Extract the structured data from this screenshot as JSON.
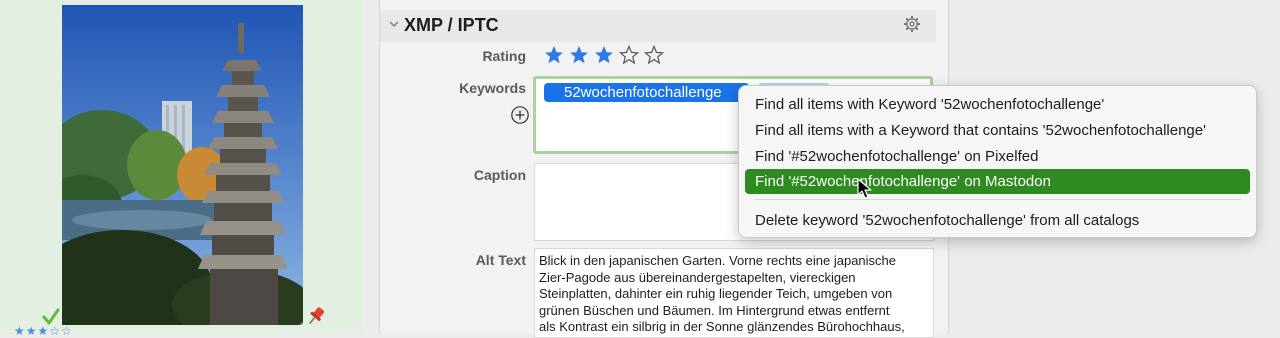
{
  "thumbnail": {
    "rating_stars": "★★★☆☆",
    "status_icon": "green-check-icon",
    "pin_icon": "red-pushpin-icon"
  },
  "inspector": {
    "section_title": "XMP / IPTC",
    "rating_label": "Rating",
    "rating": 3,
    "rating_max": 5,
    "keywords_label": "Keywords",
    "keywords": [
      "52wochenfotochallenge"
    ],
    "caption_label": "Caption",
    "caption_value": "",
    "alt_text_label": "Alt Text",
    "alt_text_value": "Blick in den japanischen Garten. Vorne rechts eine japanische\nZier-Pagode aus übereinandergestapelten, viereckigen\nSteinplatten, dahinter ein ruhig liegender Teich, umgeben von\ngrünen Büschen und Bäumen. Im Hintergrund etwas entfernt\nals Kontrast ein silbrig in der Sonne glänzendes Bürohochhaus,"
  },
  "context_menu": {
    "items": [
      "Find all items with Keyword '52wochenfotochallenge'",
      "Find all items with a Keyword that contains '52wochenfotochallenge'",
      "Find '#52wochenfotochallenge' on Pixelfed",
      "Find '#52wochenfotochallenge' on Mastodon",
      "Delete keyword '52wochenfotochallenge' from all catalogs"
    ],
    "highlighted_index": 3
  },
  "colors": {
    "accent_blue": "#1a73e8",
    "menu_highlight": "#2e8b1f",
    "keyword_border": "#a6d49b",
    "thumb_background": "#e3efe1"
  }
}
